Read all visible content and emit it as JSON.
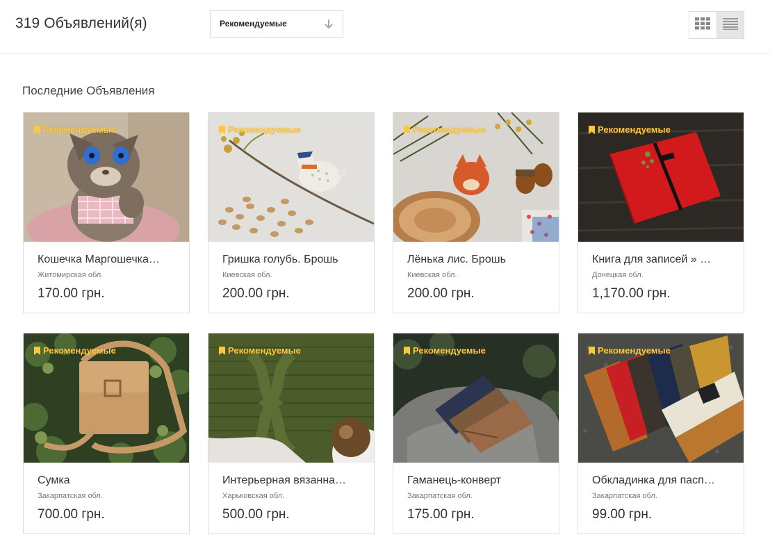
{
  "header": {
    "count_label": "319 Объявлений(я)",
    "sort_label": "Рекомендуемые",
    "view_modes": [
      {
        "icon": "grid-view-icon",
        "active": false
      },
      {
        "icon": "list-view-icon",
        "active": true
      }
    ]
  },
  "section_title": "Последние Объявления",
  "badge_color": "#ffc83a",
  "listings": [
    {
      "badge": "Рекомендуемые",
      "title": "Кошечка Маргошечка…",
      "region": "Житомирская обл.",
      "price": "170.00 грн."
    },
    {
      "badge": "Рекомендуемые",
      "title": "Гришка голубь. Брошь",
      "region": "Киевская обл.",
      "price": "200.00 грн."
    },
    {
      "badge": "Рекомендуемые",
      "title": "Лёнька лис. Брошь",
      "region": "Киевская обл.",
      "price": "200.00 грн."
    },
    {
      "badge": "Рекомендуемые",
      "title": "Книга для записей » …",
      "region": "Донецкая обл.",
      "price": "1,170.00 грн."
    },
    {
      "badge": "Рекомендуемые",
      "title": "Сумка",
      "region": "Закарпатская обл.",
      "price": "700.00 грн."
    },
    {
      "badge": "Рекомендуемые",
      "title": "Интерьерная вязанна…",
      "region": "Харьковская обл.",
      "price": "500.00 грн."
    },
    {
      "badge": "Рекомендуемые",
      "title": "Гаманець-конверт",
      "region": "Закарпатская обл.",
      "price": "175.00 грн."
    },
    {
      "badge": "Рекомендуемые",
      "title": "Обкладинка для пасп…",
      "region": "Закарпатская обл.",
      "price": "99.00 грн."
    }
  ]
}
